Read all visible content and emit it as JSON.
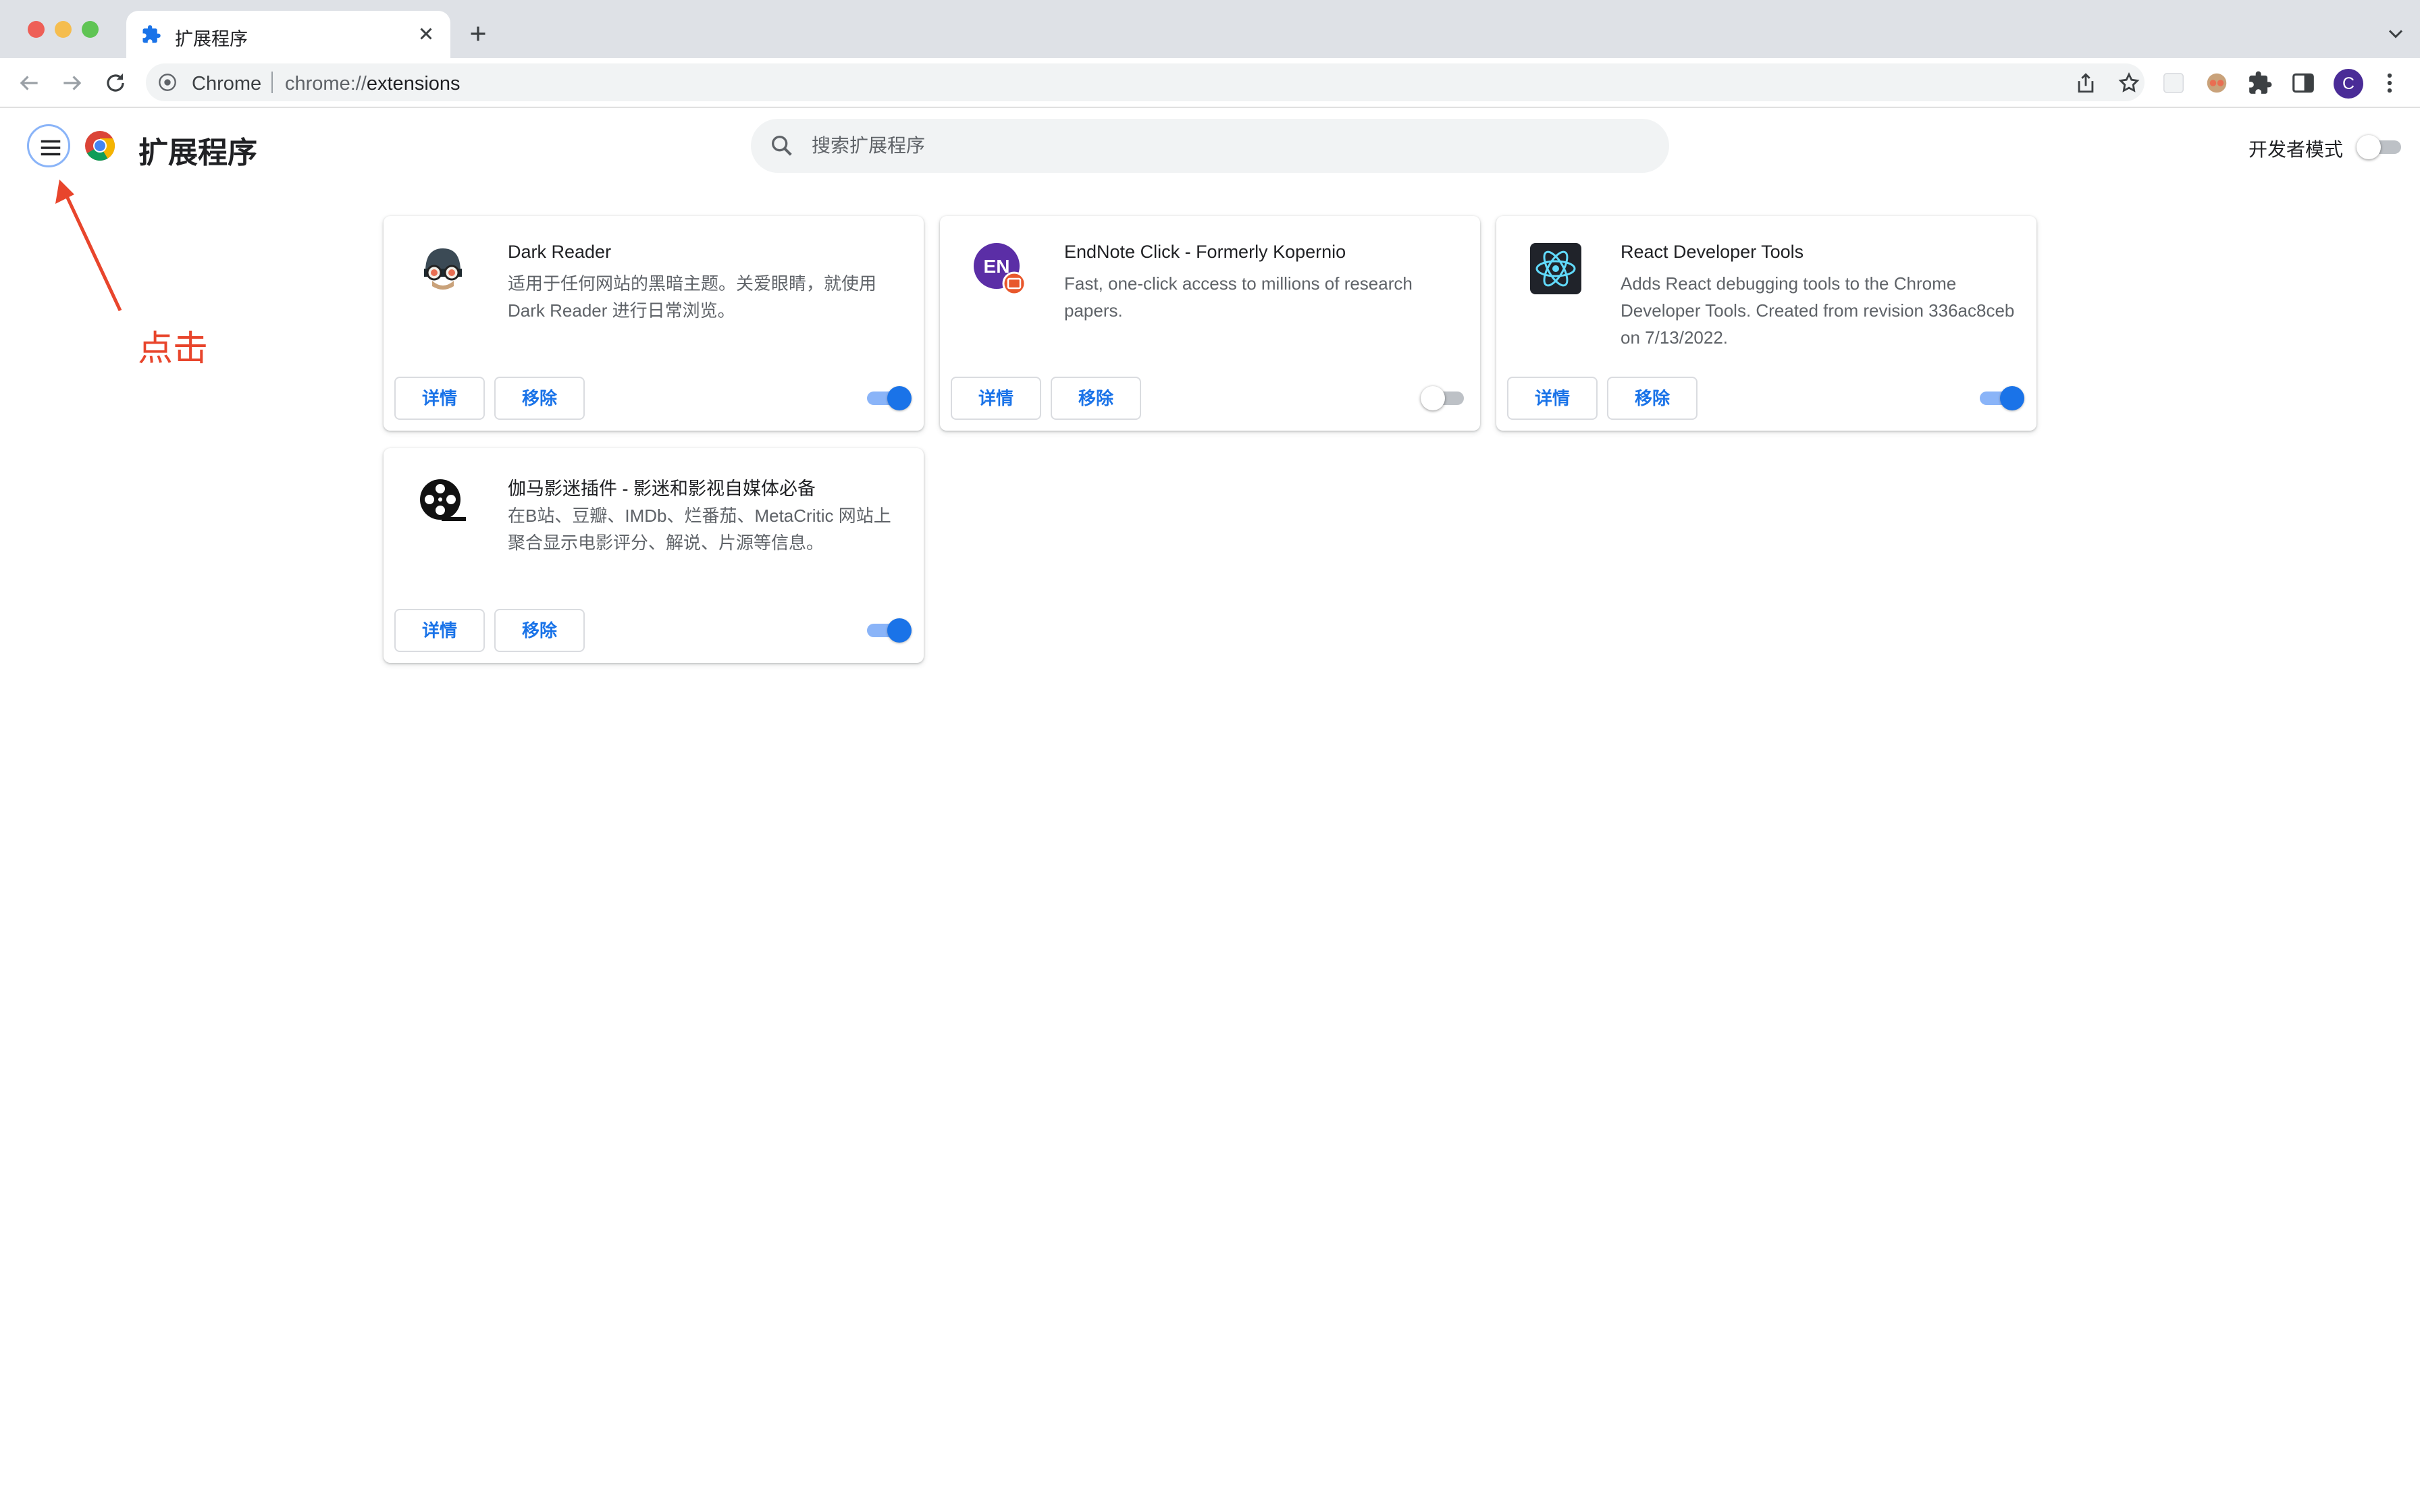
{
  "browser": {
    "tab": {
      "title": "扩展程序"
    },
    "omnibox": {
      "site_label": "Chrome",
      "url_prefix": "chrome://",
      "url_path": "extensions"
    },
    "avatar_initial": "C"
  },
  "header": {
    "title": "扩展程序",
    "search_placeholder": "搜索扩展程序",
    "dev_mode_label": "开发者模式",
    "dev_mode_enabled": false
  },
  "annotation": {
    "text": "点击",
    "color": "#e8452c"
  },
  "extensions": [
    {
      "name": "Dark Reader",
      "description": "适用于任何网站的黑暗主题。关爱眼睛，就使用 Dark Reader 进行日常浏览。",
      "details_label": "详情",
      "remove_label": "移除",
      "enabled": true,
      "icon": "dark-reader-icon"
    },
    {
      "name": "EndNote Click - Formerly Kopernio",
      "description": "Fast, one-click access to millions of research papers.",
      "details_label": "详情",
      "remove_label": "移除",
      "enabled": false,
      "icon": "endnote-icon",
      "icon_text": "EN"
    },
    {
      "name": "React Developer Tools",
      "description": "Adds React debugging tools to the Chrome Developer Tools. Created from revision 336ac8ceb on 7/13/2022.",
      "details_label": "详情",
      "remove_label": "移除",
      "enabled": true,
      "icon": "react-icon"
    },
    {
      "name": "伽马影迷插件 - 影迷和影视自媒体必备",
      "description": "在B站、豆瓣、IMDb、烂番茄、MetaCritic 网站上聚合显示电影评分、解说、片源等信息。",
      "details_label": "详情",
      "remove_label": "移除",
      "enabled": true,
      "icon": "film-reel-icon"
    }
  ],
  "colors": {
    "accent": "#1a73e8",
    "toggle_track_on": "#8ab4f8",
    "toggle_off": "#bdc1c6"
  }
}
